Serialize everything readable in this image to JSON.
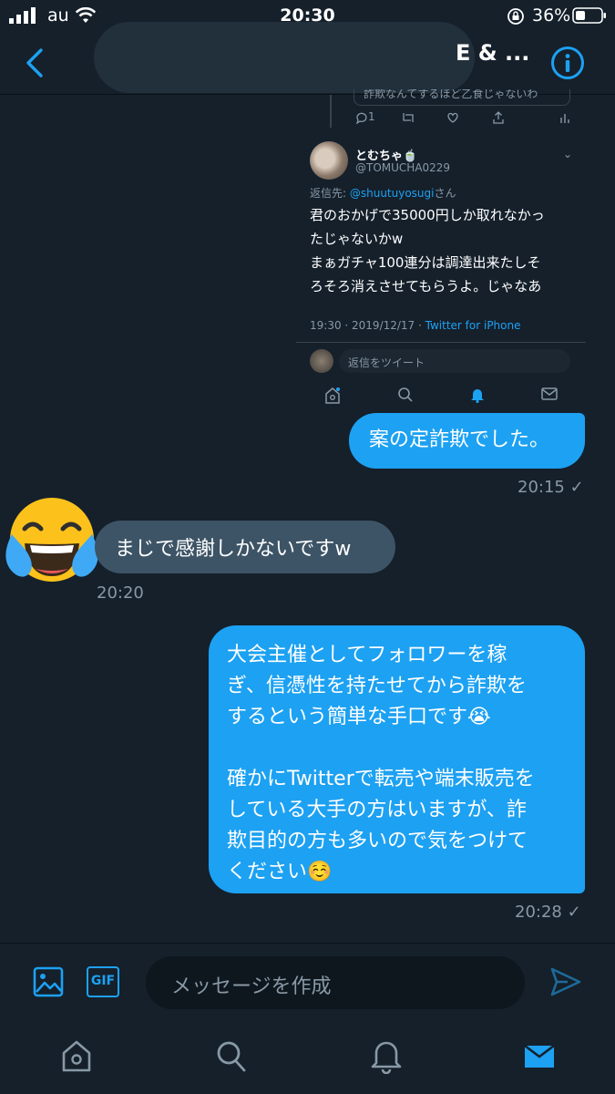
{
  "status_bar": {
    "carrier": "au",
    "time": "20:30",
    "battery": "36%"
  },
  "header": {
    "title_visible_part": "E & ...",
    "back_icon": "chevron-left-icon",
    "info_icon": "info-icon"
  },
  "embedded_tweet": {
    "quoted_text_fragment": "詐欺なんてするほど乙食じゃないわ",
    "reply_count": "1",
    "author_name": "とむちゃ🍵",
    "author_handle": "@TOMUCHA0229",
    "reply_prefix": "返信先: ",
    "reply_to": "@shuutuyosugi",
    "reply_suffix": "さん",
    "body_lines": [
      "君のおかげで35000円しか取れなかっ",
      "たじゃないかw",
      "まぁガチャ100連分は調達出来たしそ",
      "ろそろ消えさせてもらうよ。じゃなあ"
    ],
    "timestamp": "19:30 · 2019/12/17 · ",
    "source": "Twitter for iPhone",
    "reply_placeholder": "返信をツイート"
  },
  "messages": [
    {
      "direction": "out",
      "text": "案の定詐欺でした。",
      "time": "20:15",
      "status": "✓"
    },
    {
      "direction": "in",
      "text": "まじで感謝しかないですw",
      "time": "20:20",
      "avatar_emoji": "face-with-tears-of-joy"
    },
    {
      "direction": "out",
      "paragraph1": "大会主催としてフォロワーを稼\nぎ、信憑性を持たせてから詐欺を\nするという簡単な手口です😭",
      "paragraph2": "確かにTwitterで転売や端末販売を\nしている大手の方はいますが、詐\n欺目的の方も多いので気をつけて\nください☺️",
      "time": "20:28",
      "status": "✓"
    }
  ],
  "composer": {
    "placeholder": "メッセージを作成",
    "gif_label": "GIF"
  },
  "colors": {
    "background": "#15202b",
    "accent": "#1da1f2",
    "incoming_bubble": "#3d5466",
    "muted_text": "#8899a6"
  }
}
